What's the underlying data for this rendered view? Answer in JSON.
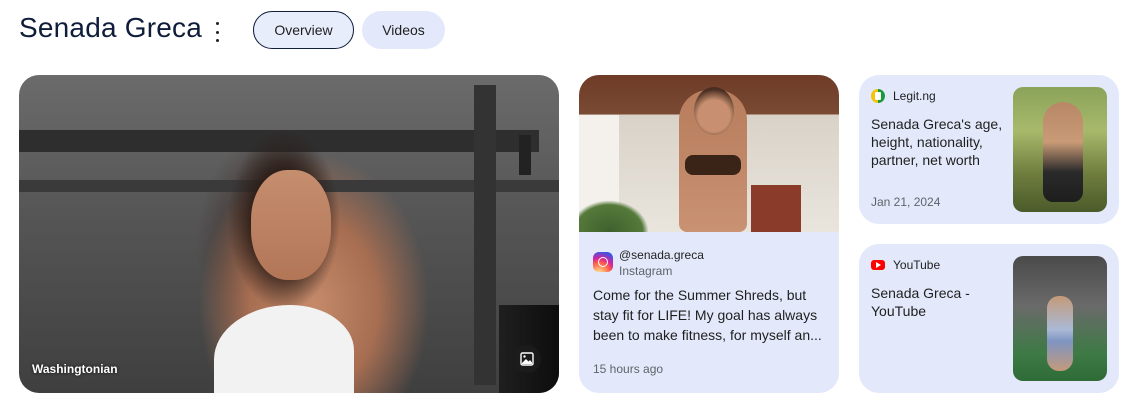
{
  "header": {
    "title": "Senada Greca",
    "tabs": [
      {
        "label": "Overview",
        "selected": true
      },
      {
        "label": "Videos",
        "selected": false
      }
    ]
  },
  "hero": {
    "source_label": "Washingtonian",
    "icon": "image-icon"
  },
  "middle_card": {
    "handle": "@senada.greca",
    "site": "Instagram",
    "icon": "instagram-icon",
    "description": "Come for the Summer Shreds, but stay fit for LIFE! My goal has always been to make fitness, for myself an...",
    "time": "15 hours ago"
  },
  "side_cards": [
    {
      "source": "Legit.ng",
      "icon": "legit-icon",
      "title": "Senada Greca's age, height, nationality, partner, net worth",
      "date": "Jan 21, 2024"
    },
    {
      "source": "YouTube",
      "icon": "youtube-icon",
      "title": "Senada Greca - YouTube"
    }
  ],
  "colors": {
    "card_bg": "#e3e9fb",
    "title": "#0f1d3a",
    "meta": "#5f6368"
  }
}
